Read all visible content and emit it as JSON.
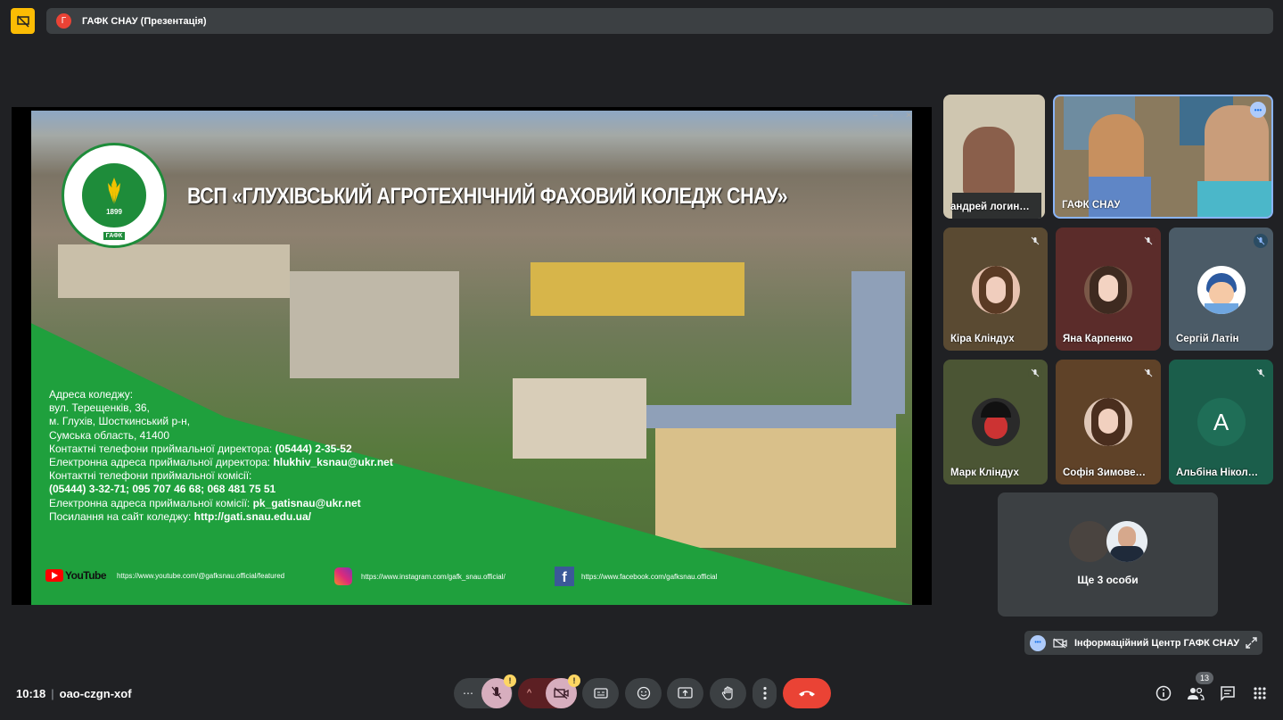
{
  "banner": {
    "avatar_letter": "Г",
    "title": "ГАФК СНАУ (Презентація)"
  },
  "slide": {
    "title": "ВСП «ГЛУХІВСЬКИЙ АГРОТЕХНІЧНИЙ ФАХОВИЙ КОЛЕДЖ СНАУ»",
    "logo_year": "1899",
    "logo_abbr": "ГАФК",
    "info": {
      "l1": "Адреса коледжу:",
      "l2": "вул. Терещенків, 36,",
      "l3": "м. Глухів, Шосткинський р-н,",
      "l4": "Сумська область, 41400",
      "l5_label": "Контактні телефони приймальної директора:",
      "l5_value": "(05444) 2-35-52",
      "l6_label": "Електронна адреса приймальної директора:",
      "l6_value": "hlukhiv_ksnau@ukr.net",
      "l7": "Контактні телефони приймальної комісії:",
      "l8": "(05444) 3-32-71; 095 707 46 68; 068 481 75 51",
      "l9_label": "Електронна адреса приймальної комісії:",
      "l9_value": "pk_gatisnau@ukr.net",
      "l10_label": "Посилання на сайт коледжу:",
      "l10_value": "http://gati.snau.edu.ua/"
    },
    "socials": {
      "youtube_word": "YouTube",
      "youtube_url": "https://www.youtube.com/@gafksnau.official/featured",
      "instagram_url": "https://www.instagram.com/gafk_snau.official/",
      "facebook_url": "https://www.facebook.com/gafksnau.official"
    }
  },
  "participants": {
    "p1": "андрей логин…",
    "p2": "ГАФК СНАУ",
    "p3": "Кіра Кліндух",
    "p4": "Яна Карпенко",
    "p5": "Сергій Латін",
    "p6": "Марк Кліндух",
    "p7": "Софія Зимове…",
    "p8": "Альбіна Нікол…",
    "p8_letter": "А",
    "others": "Ще 3 особи"
  },
  "mini_tile": {
    "label": "Інформаційний Центр ГАФК СНАУ"
  },
  "bottom": {
    "time": "10:18",
    "meeting_code": "oao-czgn-xof",
    "people_count": "13"
  },
  "colors": {
    "accent": "#8ab4f8",
    "hangup": "#ea4335",
    "warning": "#fdd663",
    "slide_green": "#1fa03d"
  }
}
